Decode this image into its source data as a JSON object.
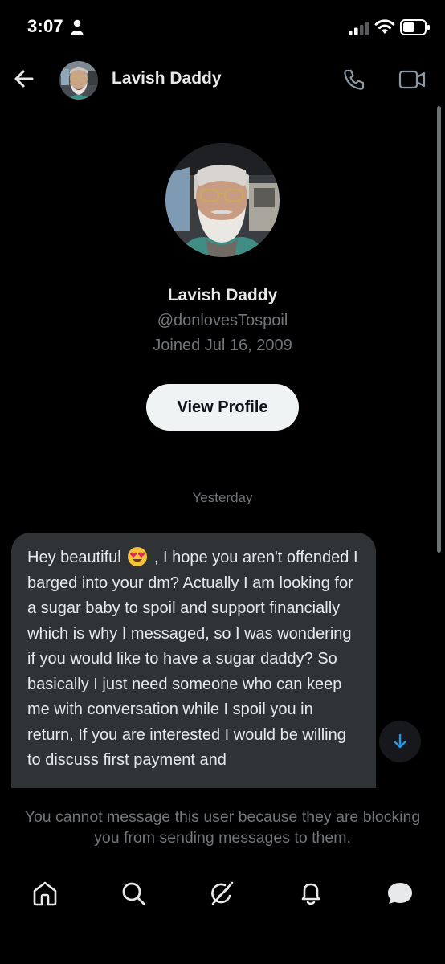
{
  "status_bar": {
    "time": "3:07"
  },
  "header": {
    "title": "Lavish Daddy"
  },
  "profile": {
    "display_name": "Lavish Daddy",
    "handle": "@donlovesTospoil",
    "joined": "Joined Jul 16, 2009",
    "view_profile_label": "View Profile"
  },
  "conversation": {
    "day_label": "Yesterday",
    "message_before_emoji": "Hey beautiful",
    "message_after_emoji": ", I hope you aren't offended I barged into your dm? Actually I am looking for a sugar baby to spoil and support financially which is why I messaged, so I was wondering if you would like to have a sugar daddy? So basically I just need someone who can keep me with conversation while I spoil you in return, If you are interested I would be willing to discuss first payment and"
  },
  "blocked_notice": "You cannot message this user because they are blocking you from sending messages to them.",
  "icons": {
    "back": "arrow-left-icon",
    "call": "phone-icon",
    "video": "video-icon",
    "scroll_down": "arrow-down-icon",
    "tabs": [
      "home-icon",
      "search-icon",
      "grok-icon",
      "bell-icon",
      "messages-icon"
    ]
  },
  "colors": {
    "background": "#000000",
    "bubble": "#2f3336",
    "muted_text": "#71767b",
    "accent": "#1d9bf0",
    "button_bg": "#eff3f4"
  }
}
